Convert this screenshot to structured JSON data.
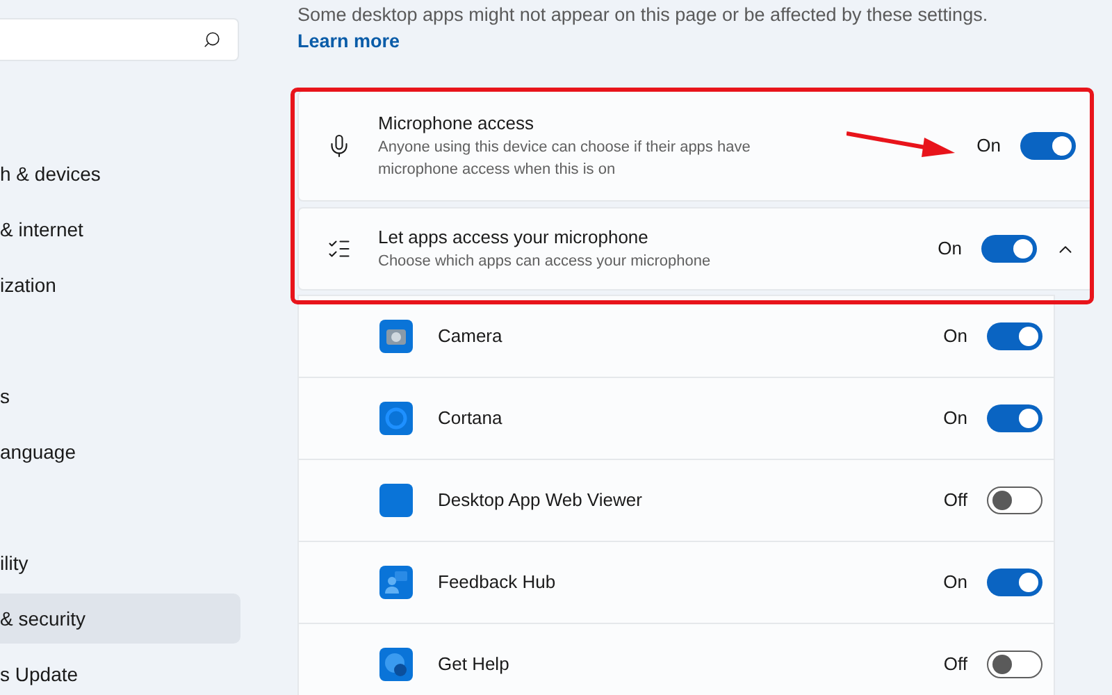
{
  "sidebar": {
    "items": [
      {
        "label": "h & devices",
        "selected": false
      },
      {
        "label": "& internet",
        "selected": false
      },
      {
        "label": "ization",
        "selected": false
      },
      {
        "label": "s",
        "selected": false
      },
      {
        "label": "anguage",
        "selected": false
      },
      {
        "label": "ility",
        "selected": false
      },
      {
        "label": "& security",
        "selected": true
      },
      {
        "label": "s Update",
        "selected": false
      }
    ]
  },
  "notice": {
    "text": "Some desktop apps might not appear on this page or be affected by these settings.",
    "link": "Learn more"
  },
  "settings": [
    {
      "kind": "microphone",
      "title": "Microphone access",
      "description": "Anyone using this device can choose if their apps have microphone access when this is on",
      "state_label": "On",
      "on": true
    },
    {
      "kind": "list",
      "title": "Let apps access your microphone",
      "description": "Choose which apps can access your microphone",
      "state_label": "On",
      "on": true,
      "expanded": true
    }
  ],
  "apps": [
    {
      "kind": "camera",
      "name": "Camera",
      "state_label": "On",
      "on": true
    },
    {
      "kind": "cortana",
      "name": "Cortana",
      "state_label": "On",
      "on": true
    },
    {
      "kind": "plain",
      "name": "Desktop App Web Viewer",
      "state_label": "Off",
      "on": false
    },
    {
      "kind": "feedback",
      "name": "Feedback Hub",
      "state_label": "On",
      "on": true
    },
    {
      "kind": "help",
      "name": "Get Help",
      "state_label": "Off",
      "on": false
    }
  ]
}
